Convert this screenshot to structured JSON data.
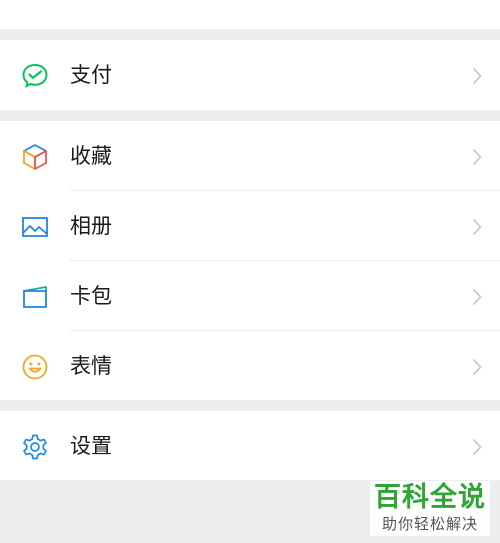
{
  "menu": {
    "pay": {
      "label": "支付",
      "icon": "wechat-pay-icon"
    },
    "favorites": {
      "label": "收藏",
      "icon": "cube-icon"
    },
    "album": {
      "label": "相册",
      "icon": "image-icon"
    },
    "wallet": {
      "label": "卡包",
      "icon": "card-wallet-icon"
    },
    "stickers": {
      "label": "表情",
      "icon": "smiley-icon"
    },
    "settings": {
      "label": "设置",
      "icon": "gear-icon"
    }
  },
  "watermark": {
    "title": "百科全说",
    "subtitle": "助你轻松解决"
  },
  "colors": {
    "pay_green": "#07c160",
    "blue": "#1e88e5",
    "orange": "#f5a623",
    "background": "#ededed"
  }
}
